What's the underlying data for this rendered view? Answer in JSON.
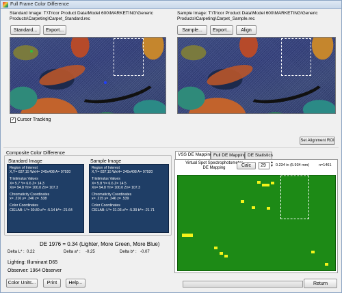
{
  "window": {
    "title": "Full Frame Color Difference"
  },
  "standard": {
    "path_lines": [
      "Standard Image:  T:\\Tricor Product Data\\Model 600\\MARKETING\\Generic",
      "Products\\Carpeting\\Carpet_Standard.rec"
    ],
    "standard_button": "Standard...",
    "export_button": "Export...",
    "cursor_tracking_label": "Cursor Tracking",
    "cursor_tracking_checked": true
  },
  "sample": {
    "path_lines": [
      "Sample Image:  T:\\Tricor Product Data\\Model 600\\MARKETING\\Generic",
      "Products\\Carpeting\\Carpet_Sample.rec"
    ],
    "sample_button": "Sample...",
    "export_button": "Export...",
    "align_button": "Align",
    "set_alignment_button": "Set Alignment ROI"
  },
  "composite": {
    "group_title": "Composite Color Difference",
    "standard_heading": "Standard Image",
    "sample_heading": "Sample Image",
    "standard_box": {
      "roi_title": "Region of Interest",
      "roi_values": "X,Y= 837,15   WxH= 240x408   A= 97920",
      "tristimulus_title": "Tristimulus Values",
      "tristimulus_1": "X= 5.7    Y= 6.6    Z= 14.3",
      "tristimulus_2": "Xn= 94.8  Yn= 100.0  Zn= 107.3",
      "chroma_title": "Chromaticity Coordinates",
      "chroma_values": "x= .216  y= .246  z= .538",
      "color_title": "Color Coordinates",
      "color_values": "CIELAB: L*= 30.80 a*= -5.14 b*= -21.64"
    },
    "sample_box": {
      "roi_title": "Region of Interest",
      "roi_values": "X,Y= 837,15   WxH= 240x408   A= 97920",
      "tristimulus_title": "Tristimulus Values",
      "tristimulus_1": "X= 5.8    Y= 6.6    Z= 14.5",
      "tristimulus_2": "Xn= 94.8  Yn= 100.0  Zn= 107.3",
      "chroma_title": "Chromaticity Coordinates",
      "chroma_values": "x= .215  y= .246  z= .539",
      "color_title": "Color Coordinates",
      "color_values": "CIELAB: L*= 31.03 a*= -5.39 b*= -21.71"
    },
    "de_result": "DE 1976 = 0.34 (Lighter, More Green, More Blue)",
    "delta_l_label": "Delta L* :",
    "delta_l_value": "0.22",
    "delta_a_label": "Delta a* :",
    "delta_a_value": "-0.25",
    "delta_b_label": "Delta b* :",
    "delta_b_value": "-0.07"
  },
  "lighting": "Lighting:  Illuminant D65",
  "observer": "Observer:  1964 Observer",
  "bottom_buttons": {
    "color_units": "Color Units...",
    "print": "Print",
    "help": "Help...",
    "return": "Return"
  },
  "de_tabs": {
    "tabs": [
      "VSS DE Mapping",
      "Full DE Mapping",
      "DE Statistics"
    ],
    "vss_title_1": "Virtual Spot Spectrophotometer",
    "vss_title_2": "DE Mapping",
    "calc_button": "Calc",
    "spot_value": "29",
    "spot_size": "0.234 in (5.934 mm)",
    "n_value": "n=1461"
  },
  "progress_fraction": 0.0,
  "colors": {
    "data_box": "#1f3e66",
    "map_green": "#1d8a16",
    "map_yellow": "#f3f31a"
  }
}
